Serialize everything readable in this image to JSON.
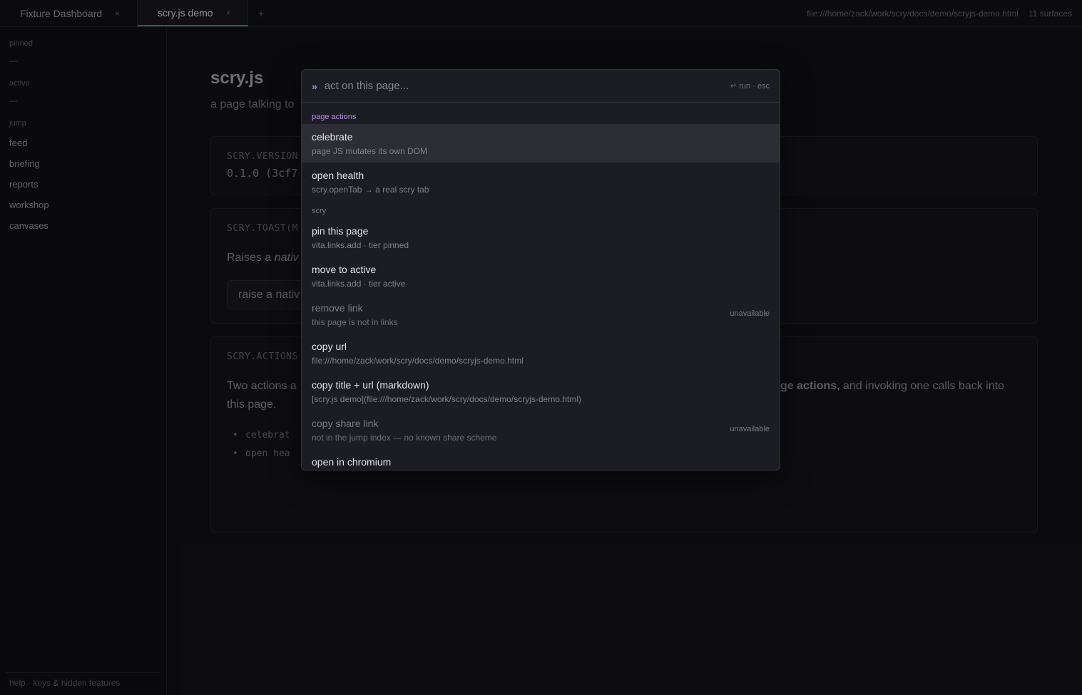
{
  "tabs": [
    {
      "label": "Fixture Dashboard",
      "close": "×"
    },
    {
      "label": "scry.js demo",
      "close": "×"
    }
  ],
  "tab_add": "+",
  "status": {
    "url": "file:///home/zack/work/scry/docs/demo/scryjs-demo.html",
    "surfaces": "11 surfaces"
  },
  "sidebar": {
    "pinned_label": "pinned",
    "pinned_empty": "—",
    "active_label": "active",
    "active_empty": "—",
    "jump_label": "jump",
    "items": [
      "feed",
      "briefing",
      "reports",
      "workshop",
      "canvases"
    ],
    "footer": "help · keys & hidden features"
  },
  "page": {
    "title": "scry.js",
    "subtitle": "a page talking to",
    "version_label": "SCRY.VERSION",
    "version_value": "0.1.0 (3cf7",
    "toast_label": "SCRY.TOAST(M",
    "toast_text_a": "Raises a ",
    "toast_text_b": "nativ",
    "toast_button": "raise a nativ",
    "actions_label": "SCRY.ACTIONS",
    "actions_text_a": "Two actions a",
    "actions_text_b": "ge actions",
    "actions_text_c": ", and invoking one calls back into",
    "actions_text_d": "this page.",
    "bullets": [
      "celebrat",
      "open hea"
    ]
  },
  "palette": {
    "chevron": "»",
    "placeholder": "act on this page...",
    "hint": "↵ run · esc",
    "groups": [
      {
        "label": "page actions",
        "items": [
          {
            "title": "celebrate",
            "sub": "page JS mutates its own DOM"
          },
          {
            "title": "open health",
            "sub": "scry.openTab → a real scry tab"
          }
        ]
      },
      {
        "label": "scry",
        "items": [
          {
            "title": "pin this page",
            "sub": "vita.links.add · tier pinned"
          },
          {
            "title": "move to active",
            "sub": "vita.links.add · tier active"
          },
          {
            "title": "remove link",
            "sub": "this page is not in links",
            "badge": "unavailable"
          },
          {
            "title": "copy url",
            "sub": "file:///home/zack/work/scry/docs/demo/scryjs-demo.html"
          },
          {
            "title": "copy title + url (markdown)",
            "sub": "[scry.js demo](file:///home/zack/work/scry/docs/demo/scryjs-demo.html)"
          },
          {
            "title": "copy share link",
            "sub": "not in the jump index — no known share scheme",
            "badge": "unavailable"
          },
          {
            "title": "open in chromium",
            "sub": ""
          }
        ]
      }
    ]
  }
}
